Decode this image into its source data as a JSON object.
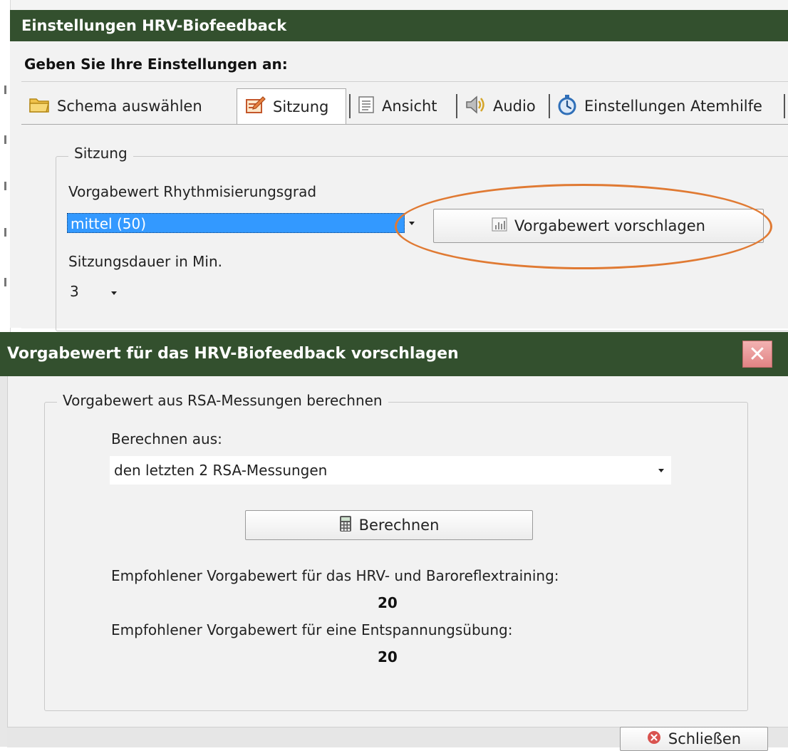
{
  "settings_dialog": {
    "title": "Einstellungen HRV-Biofeedback",
    "prompt": "Geben Sie Ihre Einstellungen an:",
    "tabs": [
      {
        "label": "Schema auswählen",
        "icon": "folder-icon"
      },
      {
        "label": "Sitzung",
        "icon": "edit-icon"
      },
      {
        "label": "Ansicht",
        "icon": "document-icon"
      },
      {
        "label": "Audio",
        "icon": "speaker-icon"
      },
      {
        "label": "Einstellungen Atemhilfe",
        "icon": "stopwatch-icon"
      }
    ],
    "active_tab": "Sitzung",
    "group_label": "Sitzung",
    "target_label": "Vorgabewert Rhythmisierungsgrad",
    "target_value": "mittel (50)",
    "suggest_button": "Vorgabewert vorschlagen",
    "duration_label": "Sitzungsdauer in Min.",
    "duration_value": "3",
    "highlight_color": "#e07a33"
  },
  "suggest_dialog": {
    "title": "Vorgabewert für das HRV-Biofeedback vorschlagen",
    "group_label": "Vorgabewert aus RSA-Messungen berechnen",
    "source_label": "Berechnen aus:",
    "source_value": "den letzten 2 RSA-Messungen",
    "calculate_button": "Berechnen",
    "hrv_label": "Empfohlener Vorgabewert für das HRV- und Baroreflextraining:",
    "hrv_value": "20",
    "relax_label": "Empfohlener Vorgabewert für eine Entspannungsübung:",
    "relax_value": "20",
    "close_button": "Schließen"
  },
  "colors": {
    "titlebar": "#33502e",
    "selection": "#3399ff",
    "window_bg": "#f2f2f2"
  }
}
